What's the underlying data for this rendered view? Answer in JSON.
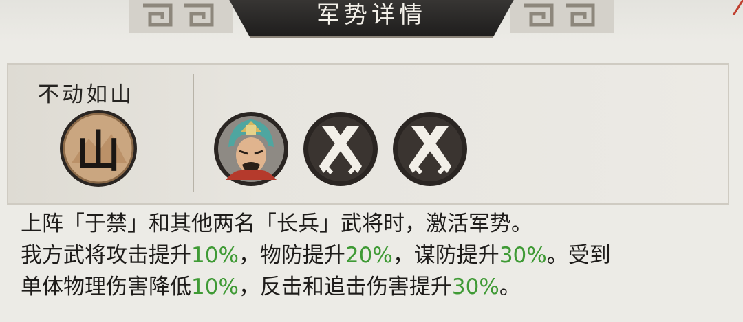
{
  "header": {
    "title": "军势详情"
  },
  "army": {
    "name": "不动如山",
    "icon": "mountain-emblem-icon",
    "icon_char": "山"
  },
  "slots": [
    {
      "icon": "general-portrait-icon",
      "state": "filled"
    },
    {
      "icon": "crossed-blades-icon",
      "state": "empty"
    },
    {
      "icon": "crossed-blades-icon",
      "state": "empty"
    }
  ],
  "description": {
    "line1": "上阵「于禁」和其他两名「长兵」武将时，激活军势。",
    "line2": {
      "t1": "我方武将攻击提升",
      "v1": "10%",
      "t2": "，物防提升",
      "v2": "20%",
      "t3": "，谋防提升",
      "v3": "30%",
      "t4": "。受到"
    },
    "line3": {
      "t1": "单体物理伤害降低",
      "v1": "10%",
      "t2": "，反击和追击伤害提升",
      "v2": "30%",
      "t3": "。"
    }
  },
  "colors": {
    "highlight": "#3f9a35",
    "text": "#1e1c1a",
    "header_plate": "#2a2927"
  }
}
